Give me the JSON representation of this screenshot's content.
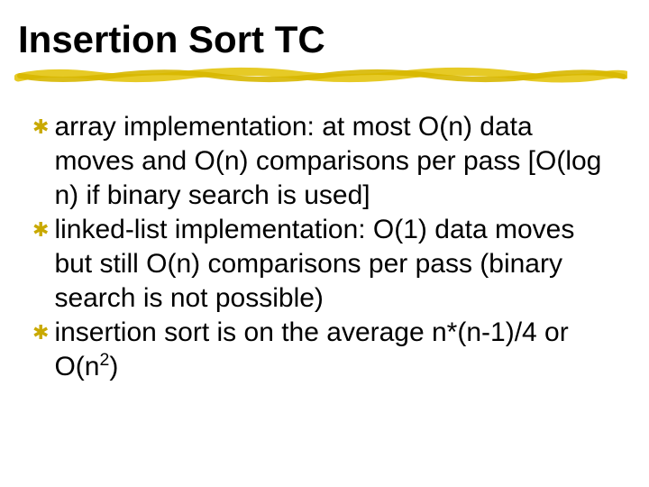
{
  "title": "Insertion Sort TC",
  "bullets": [
    {
      "text": "array implementation: at most O(n) data moves and O(n) comparisons per pass [O(log n) if binary search is used]"
    },
    {
      "text": "linked-list implementation: O(1) data moves but still O(n) comparisons per pass (binary search is not possible)"
    },
    {
      "text_html": "insertion sort is on the average n*(n-1)/4 or O(n<sup>2</sup>)"
    }
  ],
  "accent_color": "#d7b700"
}
